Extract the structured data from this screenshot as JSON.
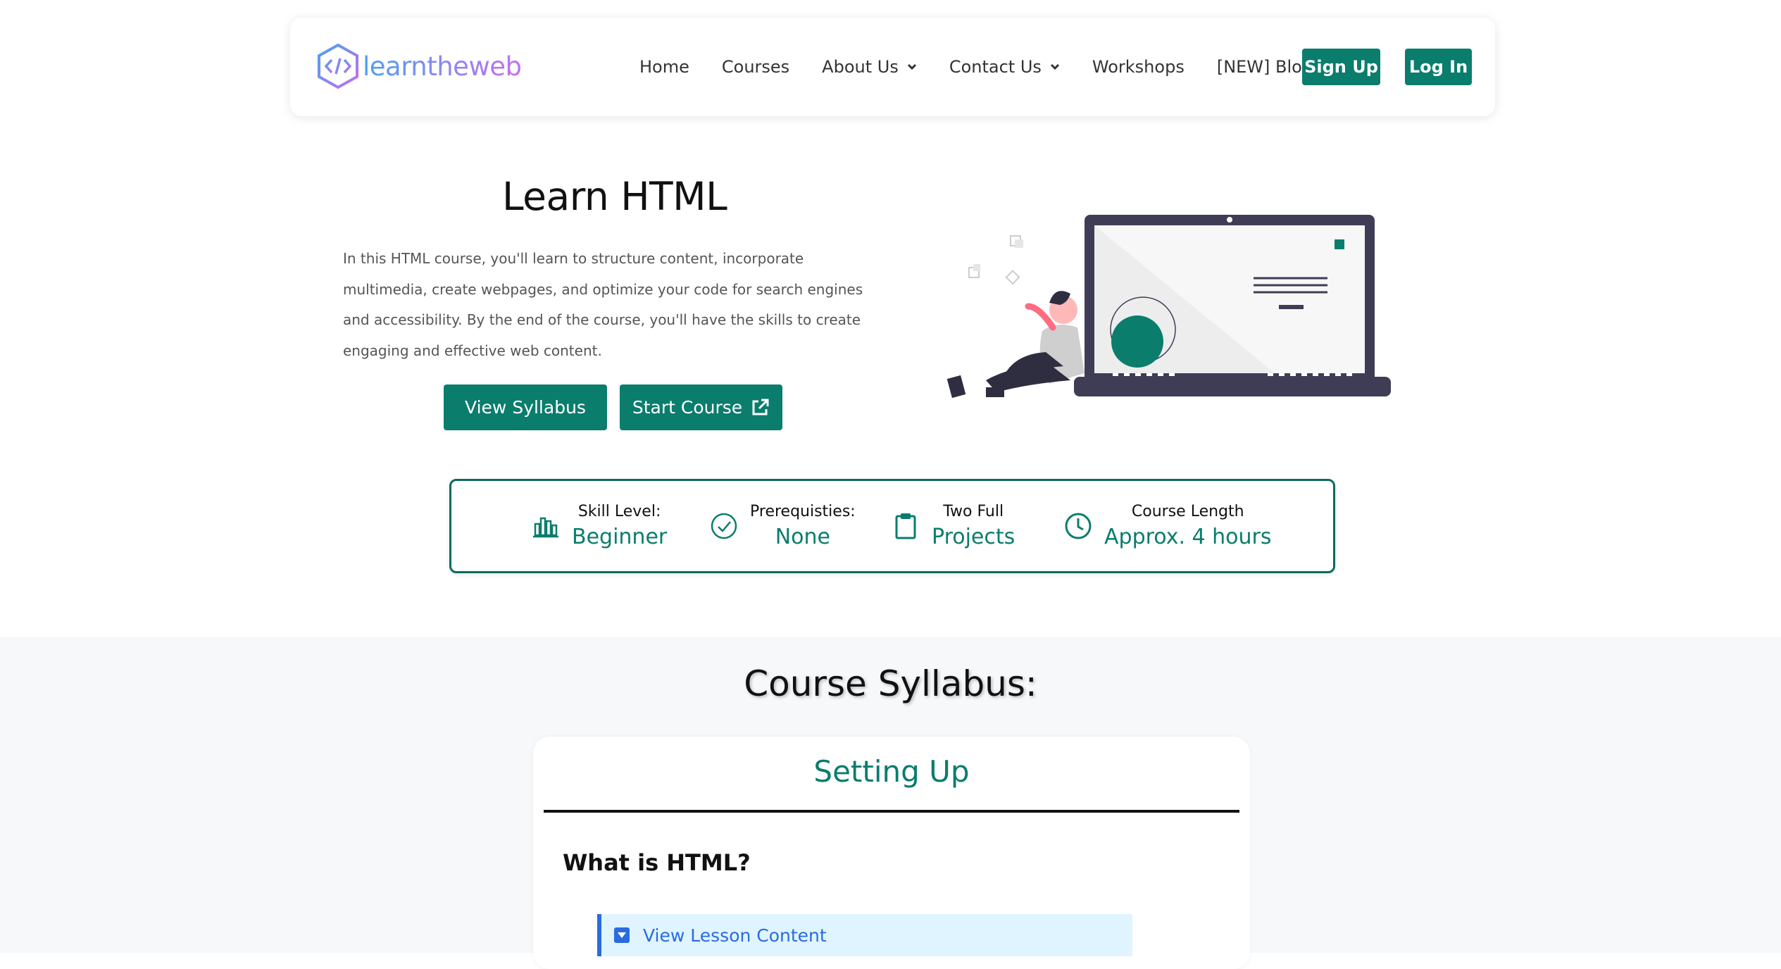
{
  "header": {
    "logo_text": "learntheweb",
    "nav": [
      {
        "label": "Home"
      },
      {
        "label": "Courses"
      },
      {
        "label": "About Us"
      },
      {
        "label": "Contact Us"
      },
      {
        "label": "Workshops"
      },
      {
        "label": "[NEW] Blog"
      }
    ],
    "signup_label": "Sign Up",
    "login_label": "Log In"
  },
  "hero": {
    "title": "Learn HTML",
    "description": "In this HTML course, you'll learn to structure content, incorporate multimedia, create webpages, and optimize your code for search engines and accessibility. By the end of the course, you'll have the skills to create engaging and effective web content.",
    "view_syllabus_label": "View Syllabus",
    "start_course_label": "Start Course"
  },
  "stats": [
    {
      "label": "Skill Level:",
      "value": "Beginner",
      "icon": "bar-chart-icon"
    },
    {
      "label": "Prerequisties:",
      "value": "None",
      "icon": "check-circle-icon"
    },
    {
      "label": "Two Full",
      "value": "Projects",
      "icon": "clipboard-icon"
    },
    {
      "label": "Course Length",
      "value": "Approx. 4 hours",
      "icon": "clock-icon"
    }
  ],
  "syllabus": {
    "title": "Course Syllabus:",
    "section_title": "Setting Up",
    "lesson_title": "What is HTML?",
    "toggle_label": "View Lesson Content"
  },
  "colors": {
    "brand_green": "#0a7d6d",
    "toggle_blue": "#2a6be0",
    "toggle_bg": "#dff4ff"
  }
}
